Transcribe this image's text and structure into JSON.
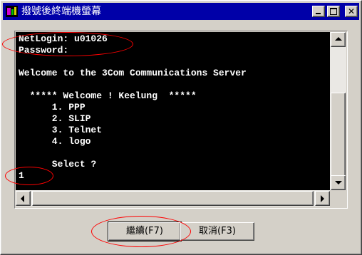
{
  "window": {
    "title": "撥號後終端機螢幕"
  },
  "titlebar": {
    "minimize_icon": "minimize-icon",
    "maximize_icon": "maximize-icon",
    "close_icon": "close-icon",
    "close_glyph": "✕"
  },
  "terminal": {
    "lines": [
      "NetLogin: u01026",
      "Password:",
      "",
      "Welcome to the 3Com Communications Server",
      "",
      "  ***** Welcome ! Keelung  *****",
      "      1. PPP",
      "      2. SLIP",
      "      3. Telnet",
      "      4. logo",
      "",
      "      Select ?",
      "1"
    ]
  },
  "buttons": {
    "continue_label": "繼續(F7)",
    "cancel_label": "取消(F3)"
  },
  "colors": {
    "titlebar": "#0000a8",
    "terminal_bg": "#000000",
    "terminal_text": "#ffffff",
    "annotation": "#ff0000"
  }
}
